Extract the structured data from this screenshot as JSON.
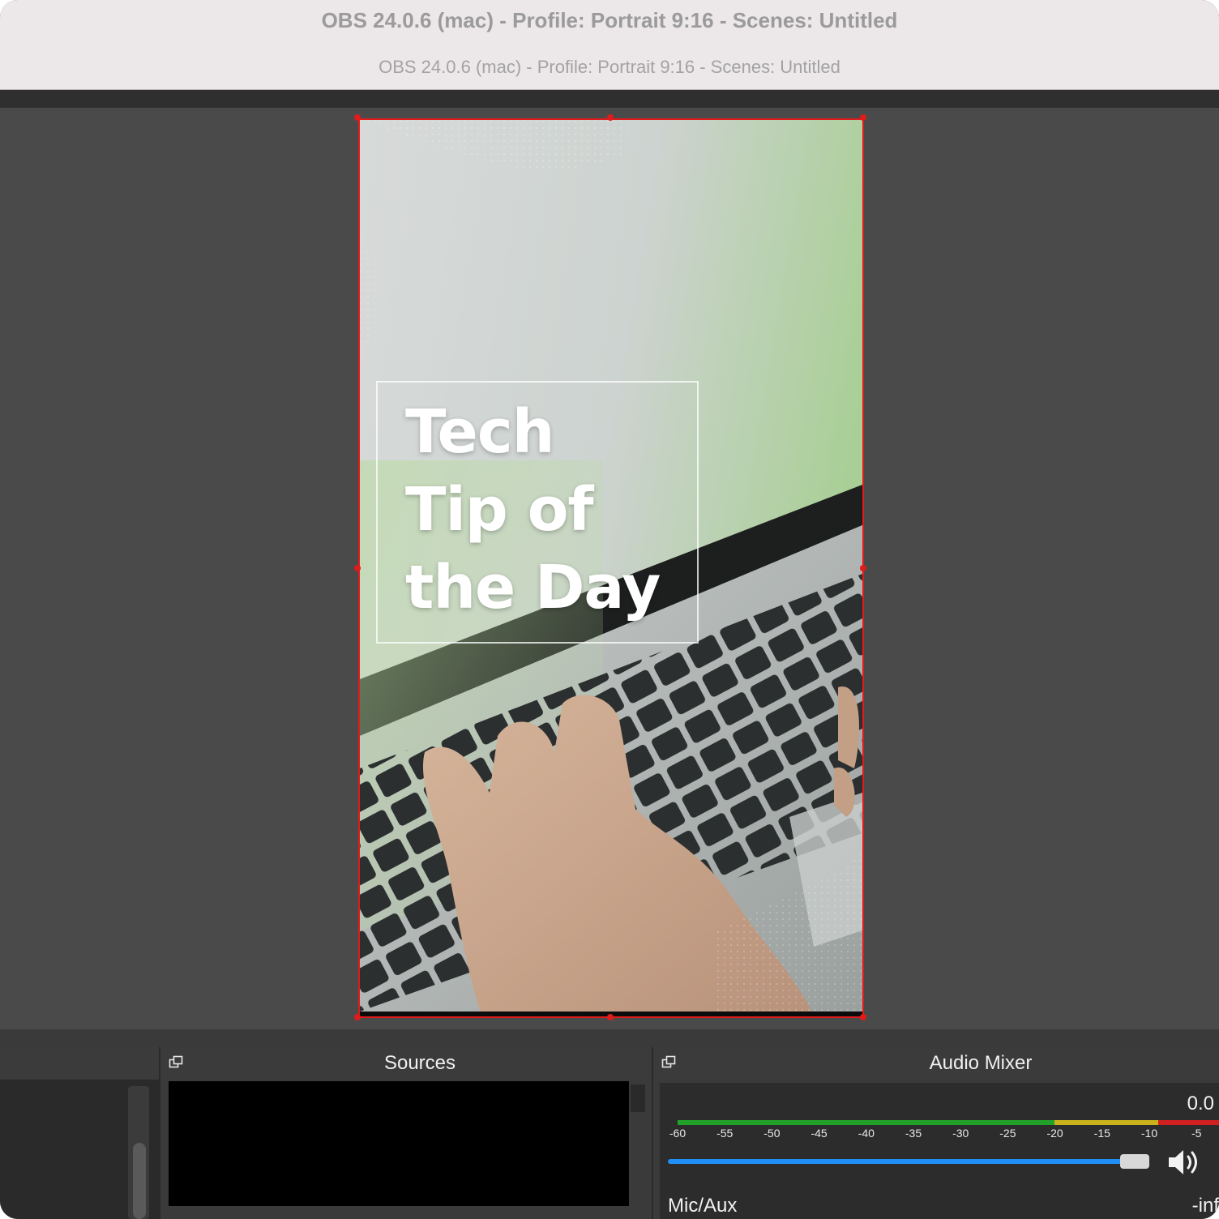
{
  "window": {
    "title": "OBS 24.0.6 (mac) - Profile: Portrait 9:16 - Scenes: Untitled",
    "subtitle": "OBS 24.0.6 (mac) - Profile: Portrait 9:16 - Scenes: Untitled"
  },
  "preview": {
    "overlay_lines": [
      "Tech",
      "Tip of",
      "the Day"
    ],
    "selection_color": "#e01b1b"
  },
  "docks": {
    "sources": {
      "title": "Sources"
    },
    "audio_mixer": {
      "title": "Audio Mixer",
      "meter_value": "0.0",
      "ticks": [
        "-60",
        "-55",
        "-50",
        "-45",
        "-40",
        "-35",
        "-30",
        "-25",
        "-20",
        "-15",
        "-10",
        "-5"
      ],
      "volume_fraction": 0.98,
      "channel": {
        "name": "Mic/Aux",
        "level": "-inf"
      },
      "colors": {
        "green": "#22a12a",
        "yellow": "#c9b21c",
        "red": "#d12020",
        "slider": "#1f8ff5"
      }
    }
  },
  "icons": [
    "float-dock-icon",
    "speaker-icon"
  ]
}
